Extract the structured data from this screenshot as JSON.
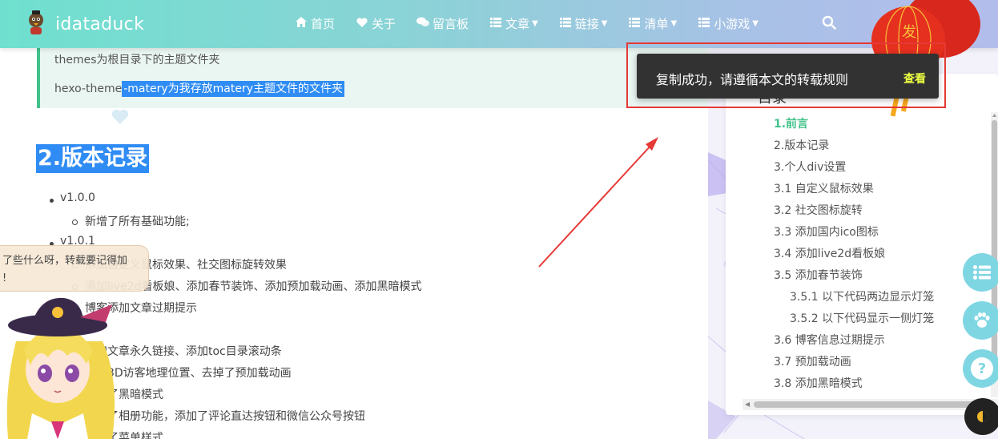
{
  "header": {
    "brand": "idataduck",
    "nav": [
      {
        "label": "首页",
        "icon": "home-icon",
        "dropdown": false
      },
      {
        "label": "关于",
        "icon": "heart-icon",
        "dropdown": false
      },
      {
        "label": "留言板",
        "icon": "comments-icon",
        "dropdown": false
      },
      {
        "label": "文章",
        "icon": "list-icon",
        "dropdown": true
      },
      {
        "label": "链接",
        "icon": "list-icon",
        "dropdown": true
      },
      {
        "label": "清单",
        "icon": "list-icon",
        "dropdown": true
      },
      {
        "label": "小游戏",
        "icon": "list-icon",
        "dropdown": true
      }
    ]
  },
  "article": {
    "quote_line1": "themes为根目录下的主题文件夹",
    "quote_line2_plain": "hexo-theme",
    "quote_line2_selected": "-matery为我存放matery主题文件的文件夹",
    "heading": "2.版本记录",
    "list": [
      {
        "level": 1,
        "text": "v1.0.0"
      },
      {
        "level": 2,
        "text": "新增了所有基础功能;"
      },
      {
        "level": 1,
        "text": "v1.0.1"
      },
      {
        "level": 2,
        "text": "添加自定义鼠标效果、社交图标旋转效果"
      },
      {
        "level": 2,
        "text": "添加live2d看板娘、添加春节装饰、添加预加载动画、添加黑暗模式"
      },
      {
        "level": 2,
        "text": "博客添加文章过期提示"
      },
      {
        "level": 2,
        "text": "添加文章永久链接、添加toc目录滚动条"
      },
      {
        "level": 2,
        "text": "添加3D访客地理位置、去掉了预加载动画"
      },
      {
        "level": 2,
        "text": "优化了黑暗模式"
      },
      {
        "level": 2,
        "text": "添加了相册功能，添加了评论直达按钮和微信公众号按钮"
      },
      {
        "level": 2,
        "text": "修改了菜单样式"
      }
    ]
  },
  "live2d": {
    "bubble_line1": "了些什么呀，转载要记得加",
    "bubble_line2": "!"
  },
  "toc": {
    "title": "目录",
    "items": [
      {
        "label": "1.前言",
        "active": true
      },
      {
        "label": "2.版本记录",
        "active": false
      },
      {
        "label": "3.个人div设置",
        "active": false
      },
      {
        "label": "3.1 自定义鼠标效果",
        "active": false
      },
      {
        "label": "3.2 社交图标旋转",
        "active": false
      },
      {
        "label": "3.3 添加国内ico图标",
        "active": false
      },
      {
        "label": "3.4 添加live2d看板娘",
        "active": false
      },
      {
        "label": "3.5 添加春节装饰",
        "active": false
      },
      {
        "label": "3.5.1 以下代码两边显示灯笼",
        "active": false
      },
      {
        "label": "3.5.2 以下代码显示一侧灯笼",
        "active": false
      },
      {
        "label": "3.6 博客信息过期提示",
        "active": false
      },
      {
        "label": "3.7 预加载动画",
        "active": false
      },
      {
        "label": "3.8 添加黑暗模式",
        "active": false
      }
    ]
  },
  "toast": {
    "message": "复制成功，请遵循本文的转载规则",
    "action": "查看"
  },
  "lantern_char": "发",
  "colors": {
    "accent": "#42c28a",
    "selection": "#2f8cf4",
    "toast_bg": "#323232",
    "toast_action": "#eeff41",
    "annotation": "#e53935"
  }
}
